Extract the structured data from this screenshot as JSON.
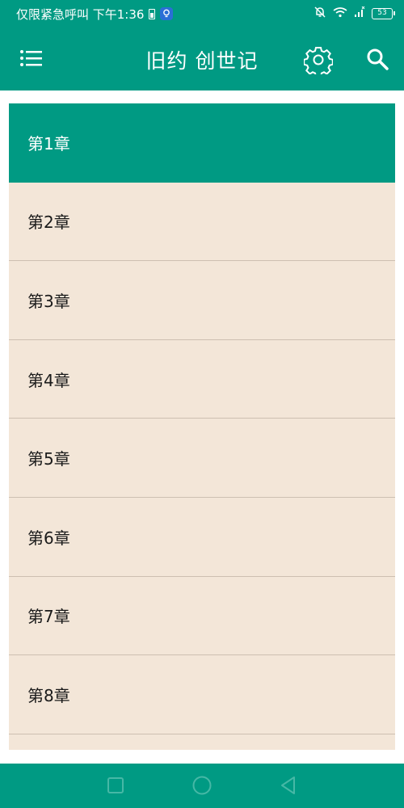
{
  "status_bar": {
    "left_text": "仅限紧急呼叫 下午1:36",
    "battery_level": "53"
  },
  "app_bar": {
    "title": "旧约 创世记"
  },
  "chapters": [
    {
      "label": "第1章",
      "selected": true
    },
    {
      "label": "第2章"
    },
    {
      "label": "第3章"
    },
    {
      "label": "第4章"
    },
    {
      "label": "第5章"
    },
    {
      "label": "第6章"
    },
    {
      "label": "第7章"
    },
    {
      "label": "第8章"
    },
    {
      "label": ""
    }
  ],
  "icons": {
    "menu": "menu-icon",
    "settings": "gear-icon",
    "search": "search-icon",
    "nav_recent": "square-icon",
    "nav_home": "circle-icon",
    "nav_back": "triangle-back-icon"
  },
  "colors": {
    "primary": "#009a83",
    "list_background": "#f3e6d8",
    "divider": "#cdbfb1",
    "text": "#1a1a1a"
  }
}
